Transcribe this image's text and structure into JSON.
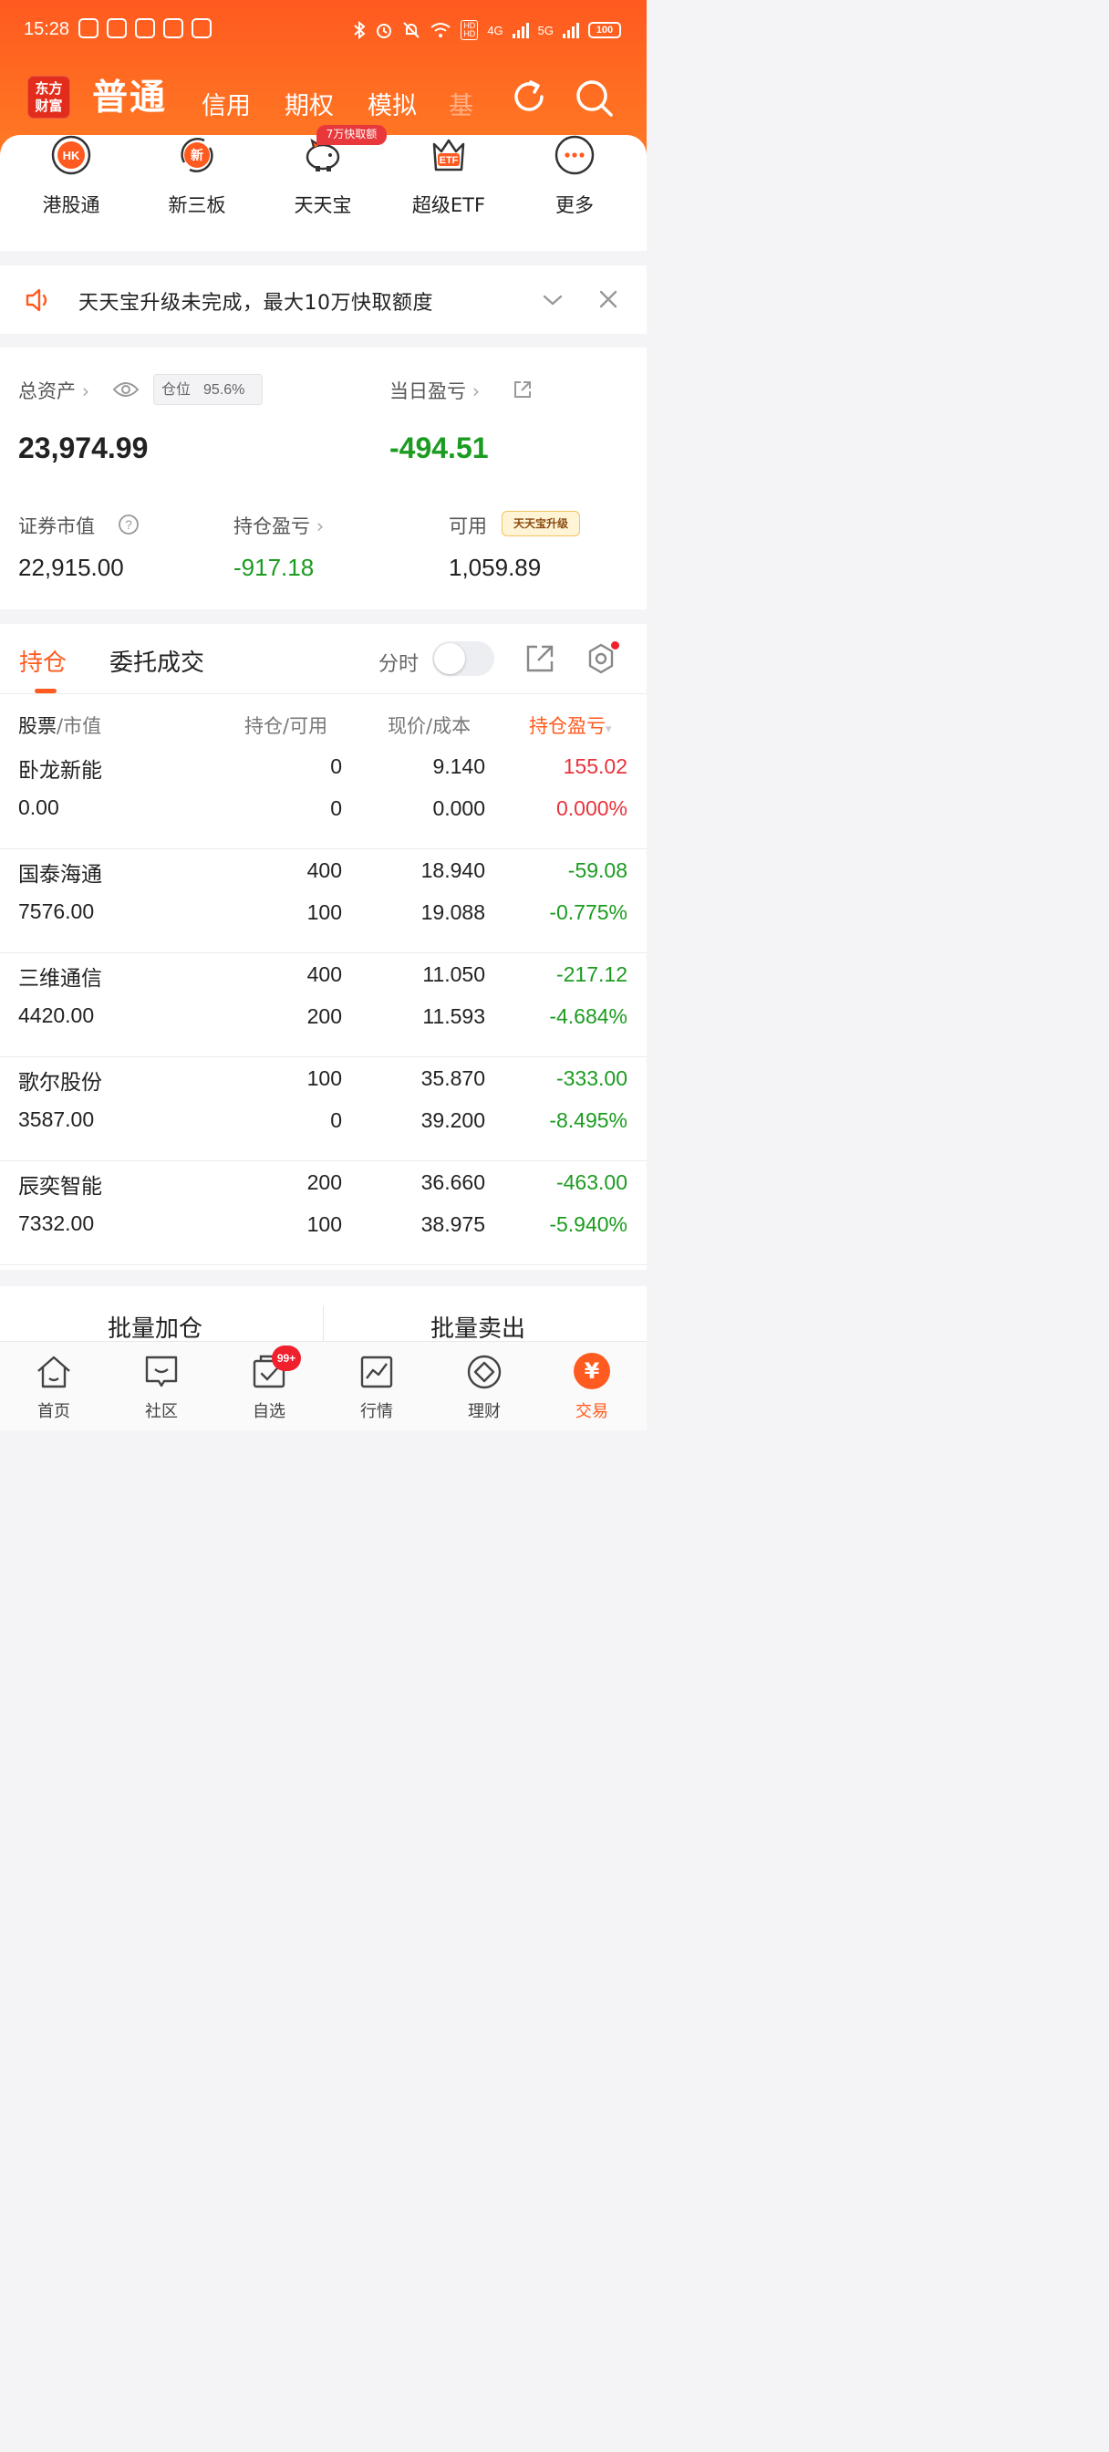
{
  "status_bar": {
    "time": "15:28",
    "network_4g": "4G",
    "network_5g": "5G",
    "battery": "100"
  },
  "header": {
    "logo_line1": "东方",
    "logo_line2": "财富",
    "tabs": [
      {
        "label": "普通",
        "active": true
      },
      {
        "label": "信用"
      },
      {
        "label": "期权"
      },
      {
        "label": "模拟"
      },
      {
        "label": "基"
      }
    ]
  },
  "quick_menu": {
    "items": [
      {
        "label": "港股通",
        "icon": "hk-icon"
      },
      {
        "label": "新三板",
        "icon": "new-board-icon"
      },
      {
        "label": "天天宝",
        "icon": "piggy-bank-icon"
      },
      {
        "label": "超级ETF",
        "icon": "etf-icon"
      },
      {
        "label": "更多",
        "icon": "more-icon"
      }
    ],
    "promo_badge": "7万快取额"
  },
  "notice": {
    "text": "天天宝升级未完成，最大10万快取额度"
  },
  "assets": {
    "total_label": "总资产",
    "position_label": "仓位",
    "position_value": "95.6%",
    "total_value": "23,974.99",
    "daily_pnl_label": "当日盈亏",
    "daily_pnl_value": "-494.51",
    "market_value_label": "证券市值",
    "market_value": "22,915.00",
    "holding_pnl_label": "持仓盈亏",
    "holding_pnl_value": "-917.18",
    "available_label": "可用",
    "available_value": "1,059.89",
    "upgrade_tag": "天天宝升级"
  },
  "holdings": {
    "tab_active": "持仓",
    "tab_other": "委托成交",
    "toggle_label": "分时",
    "columns": {
      "stock": "股票",
      "market": "/市值",
      "position": "持仓/可用",
      "price": "现价/成本",
      "pnl": "持仓盈亏"
    },
    "rows": [
      {
        "name": "卧龙新能",
        "value": "0.00",
        "hold": "0",
        "avail": "0",
        "price": "9.140",
        "cost": "0.000",
        "pnl": "155.02",
        "pct": "0.000%",
        "dir": "up"
      },
      {
        "name": "国泰海通",
        "value": "7576.00",
        "hold": "400",
        "avail": "100",
        "price": "18.940",
        "cost": "19.088",
        "pnl": "-59.08",
        "pct": "-0.775%",
        "dir": "down"
      },
      {
        "name": "三维通信",
        "value": "4420.00",
        "hold": "400",
        "avail": "200",
        "price": "11.050",
        "cost": "11.593",
        "pnl": "-217.12",
        "pct": "-4.684%",
        "dir": "down"
      },
      {
        "name": "歌尔股份",
        "value": "3587.00",
        "hold": "100",
        "avail": "0",
        "price": "35.870",
        "cost": "39.200",
        "pnl": "-333.00",
        "pct": "-8.495%",
        "dir": "down"
      },
      {
        "name": "辰奕智能",
        "value": "7332.00",
        "hold": "200",
        "avail": "100",
        "price": "36.660",
        "cost": "38.975",
        "pnl": "-463.00",
        "pct": "-5.940%",
        "dir": "down"
      }
    ]
  },
  "batch": {
    "add_label": "批量加仓",
    "sell_label": "批量卖出"
  },
  "bottom_nav": {
    "items": [
      {
        "label": "首页",
        "icon": "home-icon"
      },
      {
        "label": "社区",
        "icon": "community-icon"
      },
      {
        "label": "自选",
        "icon": "watchlist-icon"
      },
      {
        "label": "行情",
        "icon": "market-icon"
      },
      {
        "label": "理财",
        "icon": "wealth-icon"
      },
      {
        "label": "交易",
        "icon": "trade-icon",
        "active": true
      }
    ],
    "watchlist_badge": "99+",
    "trade_glyph": "¥"
  },
  "colors": {
    "brand": "#ff5a1f",
    "up": "#e8333c",
    "down": "#1b9b20"
  }
}
